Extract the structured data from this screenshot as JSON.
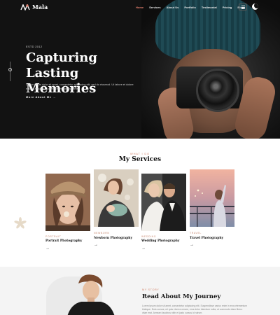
{
  "brand": {
    "name": "Mala"
  },
  "nav": {
    "items": [
      {
        "label": "Home",
        "active": true
      },
      {
        "label": "Services",
        "active": false
      },
      {
        "label": "About Us",
        "active": false
      },
      {
        "label": "Portfolio",
        "active": false
      },
      {
        "label": "Testimonial",
        "active": false
      },
      {
        "label": "Pricing",
        "active": false
      },
      {
        "label": "Blog",
        "active": false
      }
    ],
    "menu_icon": "hamburger-icon",
    "theme_icon": "moon-icon"
  },
  "hero": {
    "eyebrow": "ESTD 2012",
    "title": "Capturing Lasting Memories",
    "description": "Lorem ipsum dolor sit amet, consectetur adipiscing elit, sed do eiusmod. Ut labore et dolore magna aliqua. Ut Lorem ipsum dolor sit amet.",
    "cta": "More About Me →"
  },
  "services": {
    "eyebrow": "WHAT I DO",
    "title": "My Services",
    "cards": [
      {
        "category": "PORTRAIT",
        "title": "Portrait Photography",
        "arrow": "→"
      },
      {
        "category": "NEWBORN",
        "title": "Newborn Photography",
        "arrow": "→"
      },
      {
        "category": "WEDDING",
        "title": "Wedding Photography",
        "arrow": "→"
      },
      {
        "category": "TRAVEL",
        "title": "Travel Photography",
        "arrow": "→"
      }
    ]
  },
  "about": {
    "eyebrow": "MY STORY",
    "title": "Read About My Journey",
    "text": "Lorem ipsum dolor sit amet, consectetur adipiscing elit. Suspendisse varius enim in eros elementum tristique. Duis cursus, mi quis viverra ornare, eros dolor interdum nulla, ut commodo diam libero vitae erat. Aenean faucibus nibh et justo cursus id rutrum."
  },
  "colors": {
    "accent": "#e7816f",
    "dark": "#121212",
    "light_bg": "#f4f4f4"
  }
}
